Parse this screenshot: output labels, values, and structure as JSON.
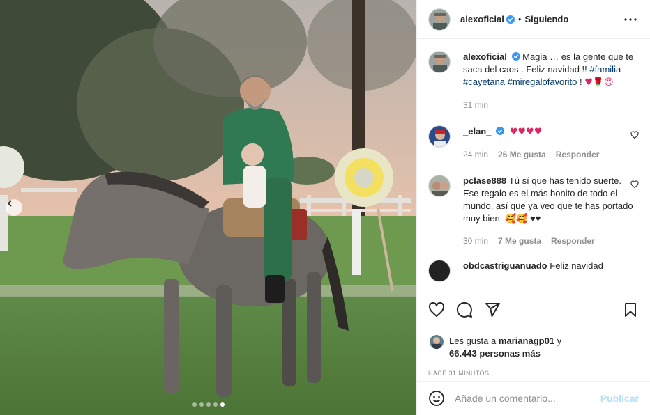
{
  "post": {
    "username": "alexoficial",
    "follow_status": "Siguiendo",
    "separator": "•",
    "caption_text": "Magia … es la gente que te saca del caos . Feliz navidad !!",
    "hashtags": [
      "#familia",
      "#cayetana",
      "#miregalofavorito"
    ],
    "caption_end": "!",
    "caption_emojis": "♥🌹😍",
    "caption_time": "31 min",
    "carousel": {
      "count": 5,
      "active_index": 4
    }
  },
  "comments": [
    {
      "username": "_elan_",
      "verified": true,
      "text": "♥♥♥♥",
      "time": "24 min",
      "likes": "26 Me gusta",
      "reply": "Responder"
    },
    {
      "username": "pclase888",
      "verified": false,
      "text": "Tú sí que has tenido suerte. Ese regalo es el más bonito de todo el mundo, así que ya veo que te has portado muy bien. 🥰🥰 ♥♥",
      "time": "30 min",
      "likes": "7 Me gusta",
      "reply": "Responder"
    }
  ],
  "partial_comment": {
    "username": "obdcastriguanuado",
    "text": "Feliz navidad"
  },
  "likes": {
    "prefix": "Les gusta a",
    "user": "marianagp01",
    "joiner": "y",
    "count": "66.443",
    "suffix": "personas más"
  },
  "timestamp": "HACE 31 MINUTOS",
  "comment_box": {
    "placeholder": "Añade un comentario...",
    "publish_label": "Publicar"
  },
  "icons": {
    "more": "more-horizontal-icon",
    "verified": "verified-badge-icon",
    "like": "heart-icon",
    "comment": "comment-icon",
    "share": "share-plane-icon",
    "save": "bookmark-icon",
    "emoji": "emoji-smile-icon",
    "prev": "chevron-left-icon"
  },
  "colors": {
    "link": "#00376b",
    "verified": "#3897f0",
    "muted": "#8e8e8e",
    "publish": "#b2dffc",
    "heart": "#e0245e"
  }
}
